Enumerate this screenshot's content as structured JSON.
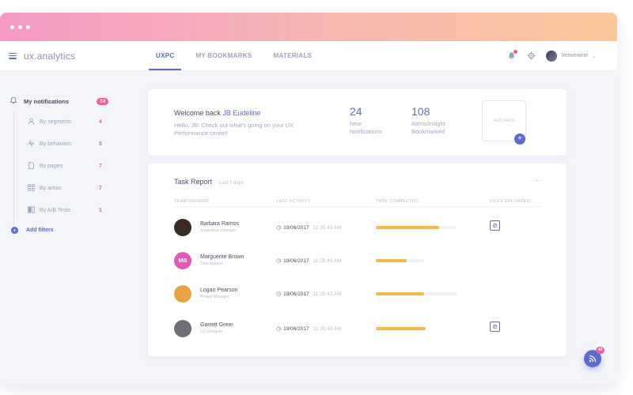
{
  "window": {
    "colors": {
      "gradient_start": "#f49ac6",
      "gradient_end": "#f9c79a",
      "accent": "#5b6acf",
      "badge": "#ef5b9c",
      "progress": "#f2b84b"
    }
  },
  "header": {
    "brand": "ux.analytics",
    "tabs": [
      {
        "label": "UXPC",
        "active": true
      },
      {
        "label": "MY BOOKMARKS",
        "active": false
      },
      {
        "label": "MATERIALS",
        "active": false
      }
    ],
    "user_name": "Verwewine"
  },
  "sidebar": {
    "notifications_label": "My notifications",
    "notifications_count": "24",
    "items": [
      {
        "label": "By segments",
        "count": "4",
        "icon": "user-icon"
      },
      {
        "label": "By behaviors",
        "count": "5",
        "icon": "pulse-icon"
      },
      {
        "label": "By pages",
        "count": "7",
        "icon": "page-icon"
      },
      {
        "label": "By areas",
        "count": "7",
        "icon": "grid-icon"
      },
      {
        "label": "By A/B Tests",
        "count": "1",
        "icon": "ab-test-icon"
      }
    ],
    "add_filters": "Add filters"
  },
  "welcome": {
    "greeting": "Welcome back",
    "user": "JB Eudeline",
    "subtitle": "Hello, JB! Check out what's going on your UX Performance center!",
    "stats": [
      {
        "value": "24",
        "label": "New Notifications"
      },
      {
        "value": "108",
        "label": "Alerts/insight Bookmarked"
      }
    ],
    "add_alerts": "Add Alerts"
  },
  "task_report": {
    "title": "Task Report",
    "period": "Last 7 days",
    "columns": [
      "TEAM MEMBER",
      "LAST ACTIVITY",
      "TASK COMPLETED",
      "FILES UPLOADED"
    ],
    "rows": [
      {
        "name": "Barbara Ramos",
        "role": "Acquisition manager",
        "date": "19/06/2017",
        "time": "11:35:43 AM",
        "progress": 0.78,
        "track": 1.0,
        "has_file": true,
        "initials": "",
        "avatar_color": "#3a2a24"
      },
      {
        "name": "Marguerite Brown",
        "role": "Data Analyst",
        "date": "19/06/2017",
        "time": "11:35:43 AM",
        "progress": 0.38,
        "track": 0.6,
        "has_file": false,
        "initials": "MB",
        "avatar_color": "#e05bb6"
      },
      {
        "name": "Logan Pearson",
        "role": "Project Manager",
        "date": "19/06/2017",
        "time": "11:35:43 AM",
        "progress": 0.6,
        "track": 1.0,
        "has_file": false,
        "initials": "",
        "avatar_color": "#e8a443"
      },
      {
        "name": "Garrett Greer",
        "role": "UX Designer",
        "date": "19/06/2017",
        "time": "11:35:43 AM",
        "progress": 0.62,
        "track": 0.6,
        "has_file": true,
        "initials": "",
        "avatar_color": "#6f6f78"
      }
    ]
  },
  "fab": {
    "badge": "40"
  }
}
